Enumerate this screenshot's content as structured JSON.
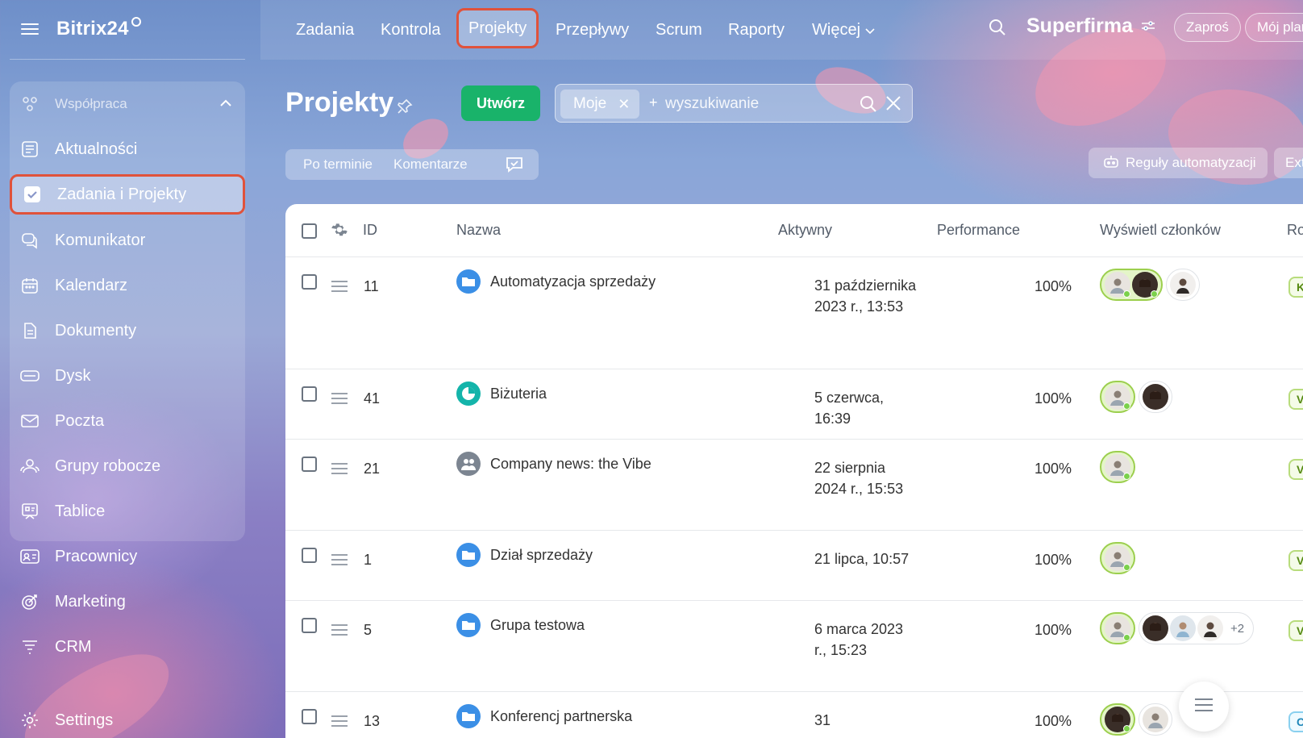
{
  "app": {
    "brand": "Bitrix24"
  },
  "sidebar": {
    "group_label": "Współpraca",
    "items": [
      {
        "label": "Aktualności",
        "icon": "news-icon"
      },
      {
        "label": "Zadania i Projekty",
        "icon": "checkbox-icon",
        "active": true
      },
      {
        "label": "Komunikator",
        "icon": "chat-icon"
      },
      {
        "label": "Kalendarz",
        "icon": "calendar-icon"
      },
      {
        "label": "Dokumenty",
        "icon": "document-icon"
      },
      {
        "label": "Dysk",
        "icon": "disk-icon"
      },
      {
        "label": "Poczta",
        "icon": "mail-icon"
      },
      {
        "label": "Grupy robocze",
        "icon": "workgroups-icon"
      },
      {
        "label": "Tablice",
        "icon": "boards-icon"
      },
      {
        "label": "Pracownicy",
        "icon": "employees-icon"
      },
      {
        "label": "Marketing",
        "icon": "marketing-icon"
      },
      {
        "label": "CRM",
        "icon": "crm-icon"
      },
      {
        "label": "Settings",
        "icon": "settings-icon"
      }
    ]
  },
  "topnav": {
    "items": [
      "Zadania",
      "Kontrola",
      "Projekty",
      "Przepływy",
      "Scrum",
      "Raporty",
      "Więcej"
    ],
    "active": "Projekty",
    "company": "Superfirma",
    "invite": "Zaproś",
    "plan": "Mój plan"
  },
  "toolbar": {
    "title": "Projekty",
    "create_label": "Utwórz",
    "filter_chip": "Moje",
    "search_placeholder": "wyszukiwanie",
    "sort_by_deadline": "Po terminie",
    "comments": "Komentarze",
    "automation_rules": "Reguły automatyzacji",
    "ext_label": "Ext"
  },
  "grid": {
    "columns": {
      "id": "ID",
      "name": "Nazwa",
      "active": "Aktywny",
      "performance": "Performance",
      "members": "Wyświetl członków",
      "role": "Ro"
    },
    "rows": [
      {
        "id": "11",
        "name": "Automatyzacja sprzedaży",
        "icon": "folder-icon",
        "date": "31 października 2023 r., 13:53",
        "performance": "100%",
        "owners": 2,
        "others": 1,
        "extra": "",
        "role": "K"
      },
      {
        "id": "41",
        "name": "Biżuteria",
        "icon": "pie-chart-icon",
        "date": "5 czerwca, 16:39",
        "performance": "100%",
        "owners": 1,
        "others": 1,
        "extra": "",
        "role": "V"
      },
      {
        "id": "21",
        "name": "Company news: the Vibe",
        "icon": "group-icon",
        "date": "22 sierpnia 2024 r., 15:53",
        "performance": "100%",
        "owners": 1,
        "others": 0,
        "extra": "",
        "role": "V"
      },
      {
        "id": "1",
        "name": "Dział sprzedaży",
        "icon": "folder-icon",
        "date": "21 lipca, 10:57",
        "performance": "100%",
        "owners": 1,
        "others": 0,
        "extra": "",
        "role": "V"
      },
      {
        "id": "5",
        "name": "Grupa testowa",
        "icon": "folder-icon",
        "date": "6 marca 2023 r., 15:23",
        "performance": "100%",
        "owners": 1,
        "others": 3,
        "extra": "+2",
        "role": "V"
      },
      {
        "id": "13",
        "name": "Konferencj partnerska",
        "icon": "folder-icon",
        "date": "31",
        "performance": "100%",
        "owners": 1,
        "others": 1,
        "extra": "",
        "role": "C"
      }
    ]
  },
  "colors": {
    "accent_green": "#19b36a",
    "highlight_red": "#e0523b",
    "folder_blue": "#3b8fe6",
    "teal": "#14b4aa"
  }
}
